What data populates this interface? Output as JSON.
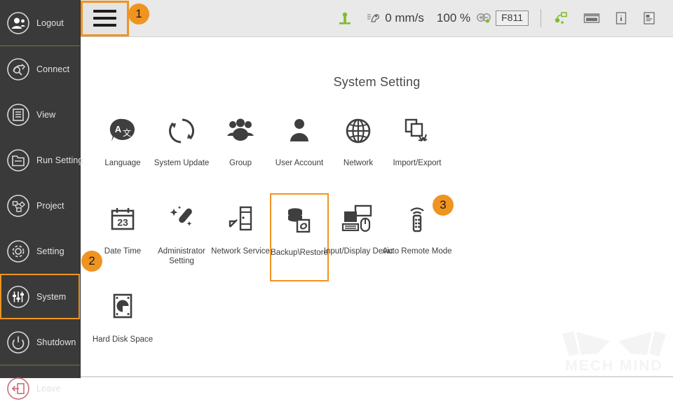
{
  "sidebar": {
    "items": [
      {
        "label": "Logout",
        "icon": "logout-user-icon",
        "selected": false,
        "accent": "#d9d9d9",
        "sep_after": true
      },
      {
        "label": "Connect",
        "icon": "connect-icon",
        "selected": false,
        "accent": "#d9d9d9",
        "sep_after": false
      },
      {
        "label": "View",
        "icon": "view-list-icon",
        "selected": false,
        "accent": "#d9d9d9",
        "sep_after": false
      },
      {
        "label": "Run Setting",
        "icon": "run-setting-icon",
        "selected": false,
        "accent": "#d9d9d9",
        "sep_after": false
      },
      {
        "label": "Project",
        "icon": "project-nodes-icon",
        "selected": false,
        "accent": "#d9d9d9",
        "sep_after": false
      },
      {
        "label": "Setting",
        "icon": "gear-icon",
        "selected": false,
        "accent": "#d9d9d9",
        "sep_after": false
      },
      {
        "label": "System",
        "icon": "sliders-icon",
        "selected": true,
        "accent": "#d9d9d9",
        "sep_after": false
      },
      {
        "label": "Shutdown",
        "icon": "power-icon",
        "selected": false,
        "accent": "#d9d9d9",
        "sep_after": true
      },
      {
        "label": "Leave",
        "icon": "leave-exit-icon",
        "selected": false,
        "accent": "#c4707c",
        "sep_after": false
      }
    ]
  },
  "topbar": {
    "menu_button": {
      "name": "hamburger-menu-button"
    },
    "robot_status_icon": "robot-base-icon",
    "speed_icon": "speed-gauge-icon",
    "speed_value": "0 mm/s",
    "override_value": "100 %",
    "override_icon": "plus-minus-icon",
    "frame_value": "F811",
    "tool_icon": "tool-path-icon",
    "keyboard_icon": "keyboard-icon",
    "info_icon": "info-icon",
    "log_icon": "log-document-icon"
  },
  "content": {
    "title": "System Setting",
    "watermark": "MECH MIND",
    "rows": [
      [
        {
          "label": "Language",
          "icon": "language-translate-icon",
          "highlighted": false,
          "wrap": false
        },
        {
          "label": "System Update",
          "icon": "system-update-icon",
          "highlighted": false,
          "wrap": false
        },
        {
          "label": "Group",
          "icon": "group-users-icon",
          "highlighted": false,
          "wrap": false
        },
        {
          "label": "User Account",
          "icon": "user-account-icon",
          "highlighted": false,
          "wrap": false
        },
        {
          "label": "Network",
          "icon": "globe-network-icon",
          "highlighted": false,
          "wrap": false
        },
        {
          "label": "Import/Export",
          "icon": "import-export-icon",
          "highlighted": false,
          "wrap": false
        }
      ],
      [
        {
          "label": "Date Time",
          "icon": "calendar-23-icon",
          "highlighted": false,
          "wrap": false
        },
        {
          "label": "Administrator Setting",
          "icon": "admin-wand-icon",
          "highlighted": false,
          "wrap": true
        },
        {
          "label": "Network Service",
          "icon": "network-service-icon",
          "highlighted": false,
          "wrap": false
        },
        {
          "label": "Backup\\Restore",
          "icon": "backup-restore-icon",
          "highlighted": true,
          "wrap": false
        },
        {
          "label": "Input/Display Devic",
          "icon": "input-display-device-icon",
          "highlighted": false,
          "wrap": false
        },
        {
          "label": "Auto Remote Mode",
          "icon": "remote-control-icon",
          "highlighted": false,
          "wrap": false
        }
      ],
      [
        {
          "label": "Hard Disk Space",
          "icon": "hard-disk-space-icon",
          "highlighted": false,
          "wrap": false
        }
      ]
    ]
  },
  "badges": [
    {
      "id": "badge1",
      "text": "1"
    },
    {
      "id": "badge2",
      "text": "2"
    },
    {
      "id": "badge3",
      "text": "3"
    }
  ],
  "colors": {
    "accent_orange": "#ef9421",
    "sidebar_bg": "#3a3a3a",
    "topbar_bg": "#e9e9e9",
    "separator_green": "#6b7a3c",
    "leave_red": "#c4707c",
    "status_green": "#78b833"
  }
}
